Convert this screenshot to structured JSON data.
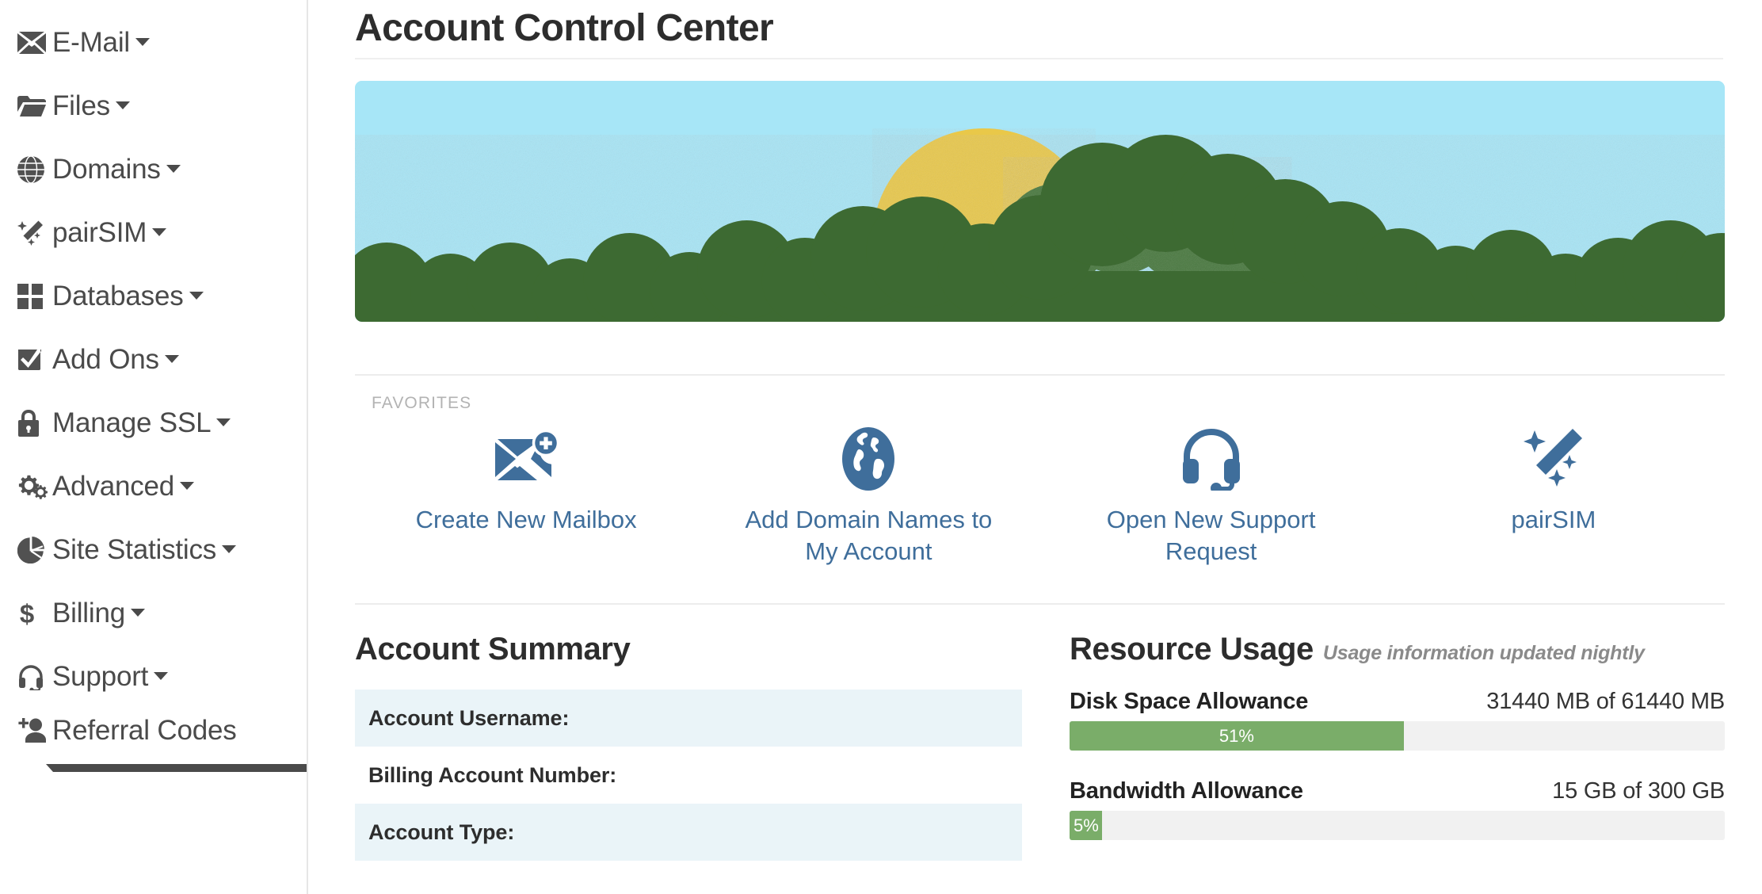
{
  "sidebar": {
    "items": [
      {
        "label": "E-Mail",
        "icon": "envelope-icon",
        "caret": true,
        "wrap": false
      },
      {
        "label": "Files",
        "icon": "folder-icon",
        "caret": true,
        "wrap": false
      },
      {
        "label": "Domains",
        "icon": "globe-icon",
        "caret": true,
        "wrap": false
      },
      {
        "label": "pairSIM",
        "icon": "magic-wand-icon",
        "caret": true,
        "wrap": false
      },
      {
        "label": "Databases",
        "icon": "grid-icon",
        "caret": true,
        "wrap": false
      },
      {
        "label": "Add Ons",
        "icon": "check-box-icon",
        "caret": true,
        "wrap": false
      },
      {
        "label": "Manage SSL",
        "icon": "lock-icon",
        "caret": true,
        "wrap": false
      },
      {
        "label": "Advanced",
        "icon": "cogs-icon",
        "caret": true,
        "wrap": false
      },
      {
        "label": "Site Statistics",
        "icon": "pie-chart-icon",
        "caret": true,
        "wrap": false
      },
      {
        "label": "Billing",
        "icon": "dollar-icon",
        "caret": true,
        "wrap": false
      },
      {
        "label": "Support",
        "icon": "headset-icon",
        "caret": true,
        "wrap": false
      },
      {
        "label": "Referral Codes",
        "icon": "user-plus-icon",
        "caret": true,
        "wrap": true
      }
    ]
  },
  "header": {
    "title": "Account Control Center"
  },
  "banner": {
    "alt": "paper-craft illustration of a sun rising behind a forest canopy",
    "sky_color": "#a7e6f7",
    "sun_color": "#e9c84a",
    "tree_color": "#3e6b30"
  },
  "favorites": {
    "section_label": "FAVORITES",
    "items": [
      {
        "label": "Create New Mailbox",
        "icon": "envelope-plus-icon"
      },
      {
        "label": "Add Domain Names to My Account",
        "icon": "globe-icon"
      },
      {
        "label": "Open New Support Request",
        "icon": "headset-icon"
      },
      {
        "label": "pairSIM",
        "icon": "magic-wand-icon"
      }
    ],
    "link_color": "#3f6e9b"
  },
  "account_summary": {
    "heading": "Account Summary",
    "rows": [
      {
        "label": "Account Username:",
        "value": ""
      },
      {
        "label": "Billing Account Number:",
        "value": ""
      },
      {
        "label": "Account Type:",
        "value": ""
      }
    ]
  },
  "resource_usage": {
    "heading": "Resource Usage",
    "subheading": "Usage information updated nightly",
    "bar_color": "#7aad69",
    "track_color": "#f1f1f1",
    "blocks": [
      {
        "name": "Disk Space Allowance",
        "value_text": "31440 MB of 61440 MB",
        "percent_text": "51%",
        "percent": 51,
        "used": 31440,
        "total": 61440,
        "unit": "MB"
      },
      {
        "name": "Bandwidth Allowance",
        "value_text": "15 GB of 300 GB",
        "percent_text": "5%",
        "percent": 5,
        "used": 15,
        "total": 300,
        "unit": "GB"
      }
    ]
  }
}
